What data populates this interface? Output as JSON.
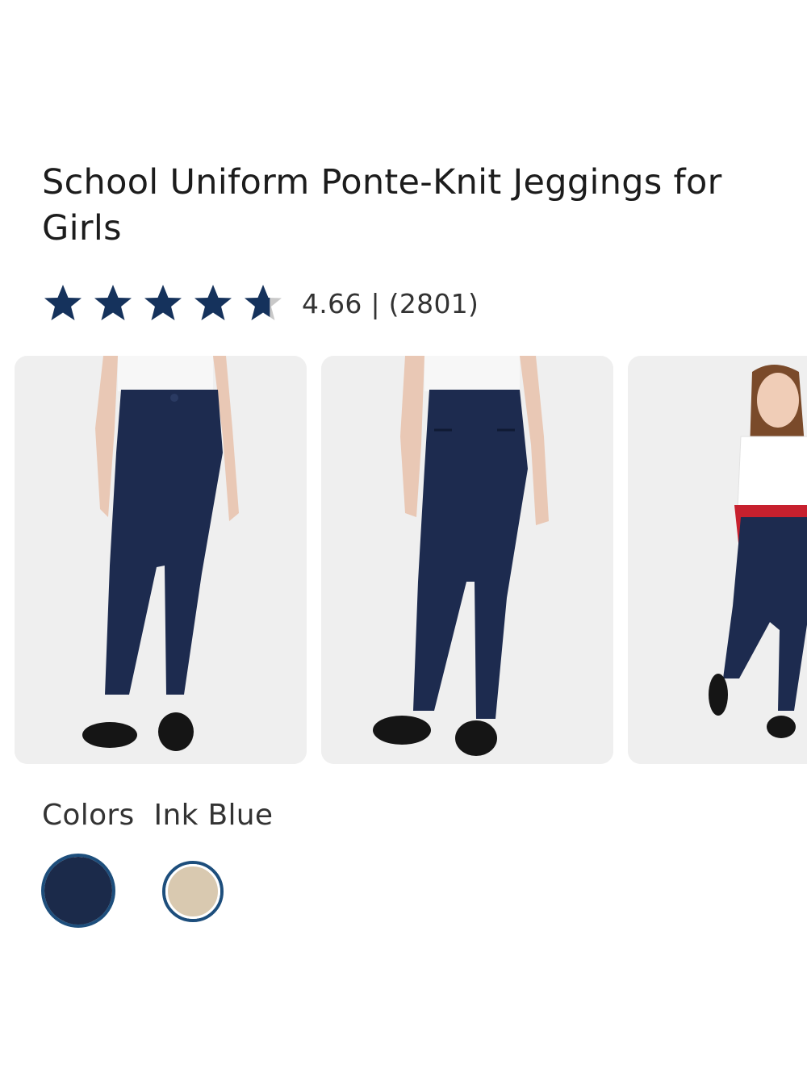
{
  "product": {
    "title": "School Uniform Ponte-Knit Jeggings for Girls",
    "rating": {
      "value": 4.66,
      "text": "4.66 | (2801)",
      "star_color": "#15325c",
      "empty_star_color": "#c9c9c9"
    }
  },
  "gallery": {
    "images": [
      {
        "label": "front-view-photo"
      },
      {
        "label": "back-view-photo"
      },
      {
        "label": "model-full-body-photo"
      }
    ]
  },
  "colors": {
    "label": "Colors",
    "selected_name": "Ink Blue",
    "swatches": [
      {
        "name": "Ink Blue",
        "hex": "#1b2a4a",
        "selected": true
      },
      {
        "name": "Khaki",
        "hex": "#d9c9b0",
        "selected": false
      }
    ]
  }
}
